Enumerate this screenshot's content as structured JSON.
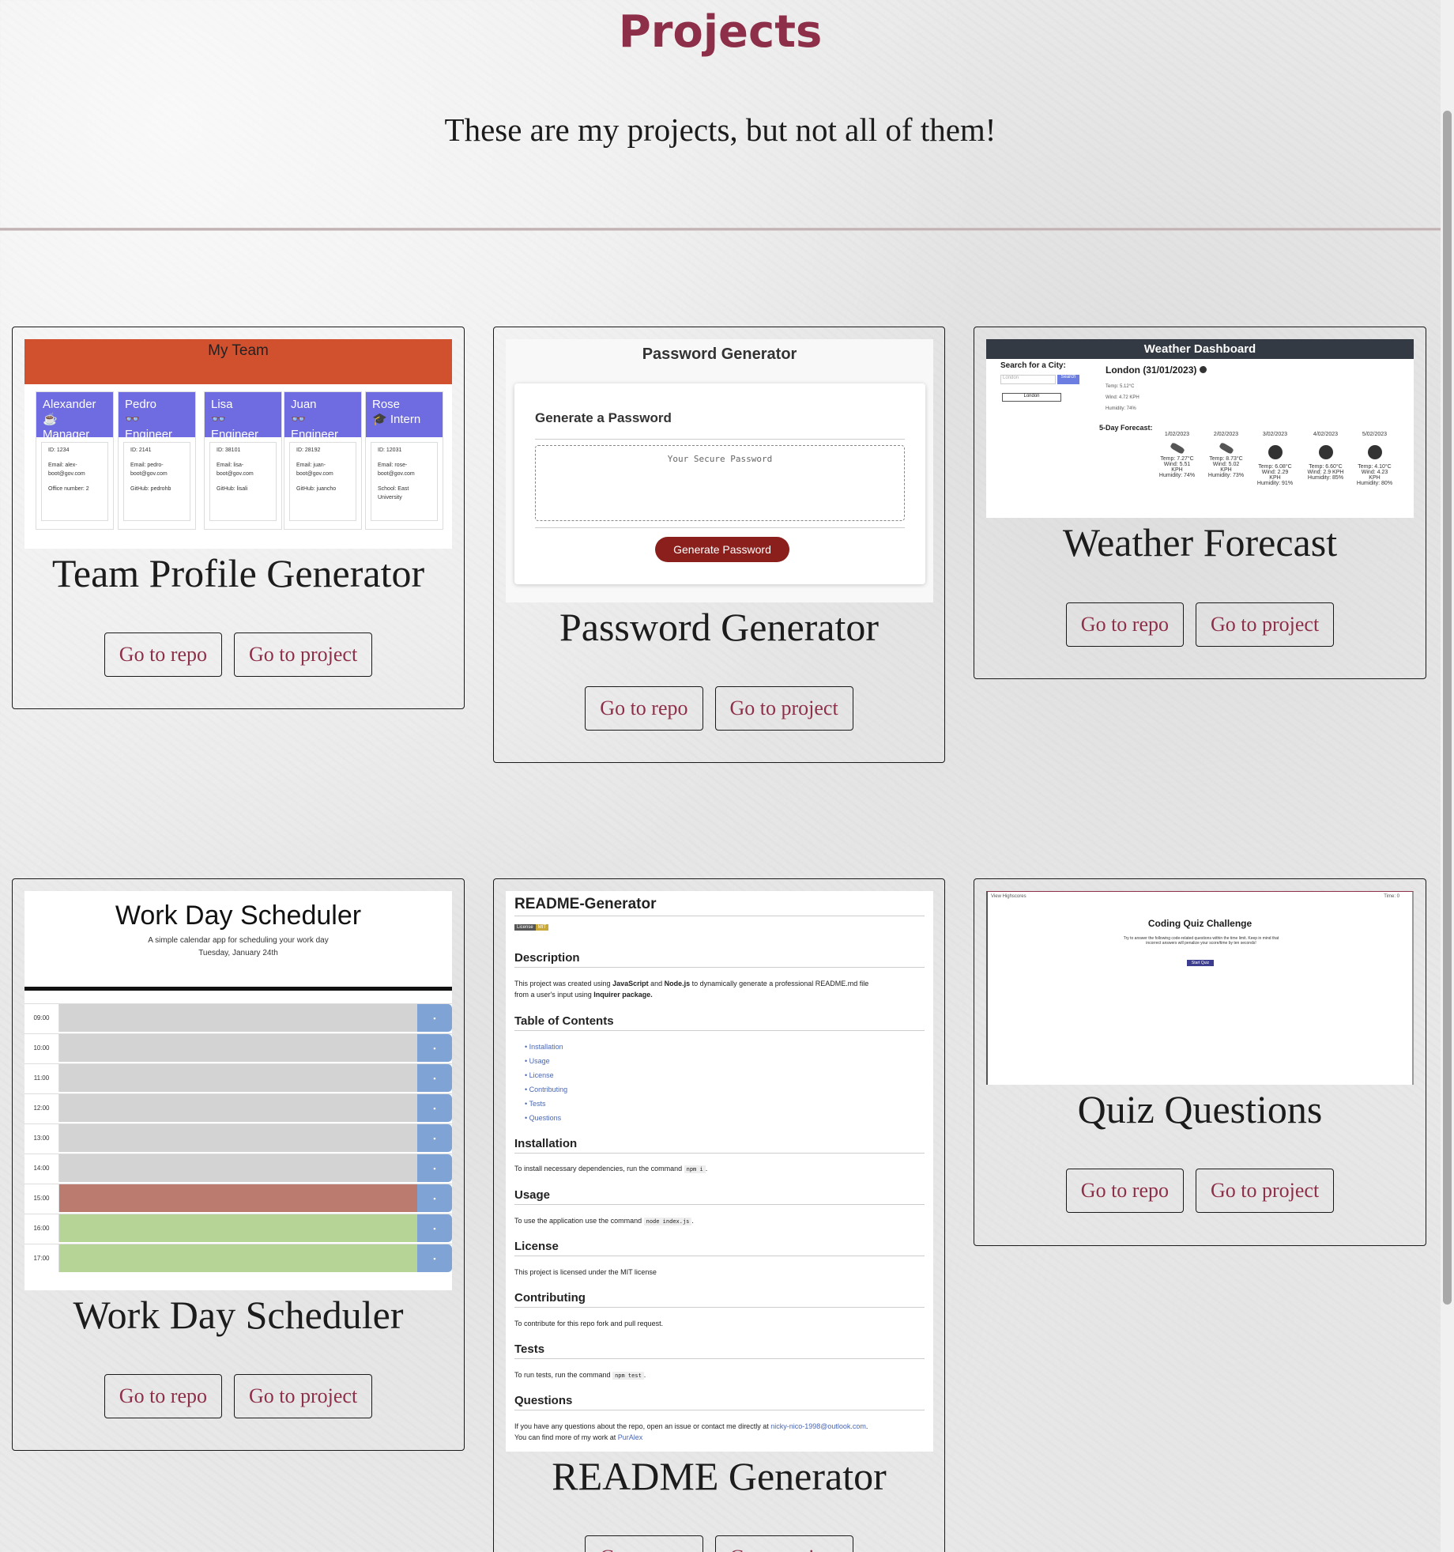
{
  "page": {
    "title": "Projects",
    "subtitle": "These are my projects, but not all of them!"
  },
  "buttons": {
    "repo": "Go to repo",
    "project": "Go to project"
  },
  "projects": [
    {
      "name": "Team Profile Generator",
      "preview": {
        "header": "My Team",
        "members": [
          {
            "name": "Alexander",
            "role": "Manager",
            "id": "ID: 1234",
            "email": "Email: alex-boot@gov.com",
            "extra": "Office number: 2"
          },
          {
            "name": "Pedro",
            "role": "Engineer",
            "id": "ID: 2141",
            "email": "Email: pedro-boot@gov.com",
            "extra": "GitHub: pedrohb"
          },
          {
            "name": "Lisa",
            "role": "Engineer",
            "id": "ID: 38101",
            "email": "Email: lisa-boot@gov.com",
            "extra": "GitHub: lisali"
          },
          {
            "name": "Juan",
            "role": "Engineer",
            "id": "ID: 28192",
            "email": "Email: juan-boot@gov.com",
            "extra": "GitHub: juancho"
          },
          {
            "name": "Rose",
            "role": "Intern",
            "id": "ID: 12031",
            "email": "Email: rose-boot@gov.com",
            "extra": "School: East University"
          }
        ]
      }
    },
    {
      "name": "Password Generator",
      "preview": {
        "header": "Password Generator",
        "card_title": "Generate a Password",
        "placeholder": "Your Secure Password",
        "button": "Generate Password"
      }
    },
    {
      "name": "Weather Forecast",
      "preview": {
        "header": "Weather Dashboard",
        "search_label": "Search for a City:",
        "search_value": "London",
        "search_button": "Search",
        "history_item": "London",
        "city": "London (31/01/2023)",
        "temp": "Temp: 5.12°C",
        "wind": "Wind: 4.72 KPH",
        "humidity": "Humidity: 74%",
        "forecast_label": "5-Day Forecast:",
        "forecast": [
          {
            "date": "1/02/2023",
            "temp": "Temp: 7.27°C",
            "wind": "Wind: 5.51 KPH",
            "humidity": "Humidity: 74%"
          },
          {
            "date": "2/02/2023",
            "temp": "Temp: 8.73°C",
            "wind": "Wind: 5.02 KPH",
            "humidity": "Humidity: 73%"
          },
          {
            "date": "3/02/2023",
            "temp": "Temp: 6.08°C",
            "wind": "Wind: 2.29 KPH",
            "humidity": "Humidity: 91%"
          },
          {
            "date": "4/02/2023",
            "temp": "Temp: 6.60°C",
            "wind": "Wind: 2.9 KPH",
            "humidity": "Humidity: 85%"
          },
          {
            "date": "5/02/2023",
            "temp": "Temp: 4.10°C",
            "wind": "Wind: 4.23 KPH",
            "humidity": "Humidity: 80%"
          }
        ]
      }
    },
    {
      "name": "Work Day Scheduler",
      "preview": {
        "header": "Work Day Scheduler",
        "tagline": "A simple calendar app for scheduling your work day",
        "date": "Tuesday, January 24th",
        "hours": [
          {
            "time": "09:00",
            "state": "past"
          },
          {
            "time": "10:00",
            "state": "past"
          },
          {
            "time": "11:00",
            "state": "past"
          },
          {
            "time": "12:00",
            "state": "past"
          },
          {
            "time": "13:00",
            "state": "past"
          },
          {
            "time": "14:00",
            "state": "past"
          },
          {
            "time": "15:00",
            "state": "present"
          },
          {
            "time": "16:00",
            "state": "future"
          },
          {
            "time": "17:00",
            "state": "future"
          }
        ],
        "colors": {
          "past": "#d3d3d3",
          "present": "#bb7b6e",
          "future": "#b6d496"
        }
      }
    },
    {
      "name": "README Generator",
      "preview": {
        "header": "README-Generator",
        "badge_left": "License",
        "badge_right": "MIT",
        "sections": {
          "description": "Description",
          "toc": "Table of Contents",
          "installation": "Installation",
          "usage": "Usage",
          "license": "License",
          "contributing": "Contributing",
          "tests": "Tests",
          "questions": "Questions"
        },
        "description_a": "This project was created using ",
        "description_js": "JavaScript",
        "description_and": " and ",
        "description_node": "Node.js",
        "description_b": " to dynamically generate a professional README.md file",
        "description_c": "from a user's input using ",
        "description_inq": "Inquirer package.",
        "toc_items": [
          "Installation",
          "Usage",
          "License",
          "Contributing",
          "Tests",
          "Questions"
        ],
        "install_text": "To install necessary dependencies, run the command ",
        "install_cmd": "npm i",
        "usage_text": "To use the application use the command ",
        "usage_cmd": "node index.js",
        "license_text": "This project is licensed under the MIT license",
        "contrib_text": "To contribute for this repo fork and pull request.",
        "tests_text": "To run tests, run the command ",
        "tests_cmd": "npm test",
        "questions_a": "If you have any questions about the repo, open an issue or contact me directly at ",
        "questions_email": "nicky-nico-1998@outlook.com",
        "questions_b": "You can find more of my work at ",
        "questions_user": "PurAlex"
      }
    },
    {
      "name": "Quiz Questions",
      "preview": {
        "highscores": "View Highscores",
        "timer": "Time: 0",
        "header": "Coding Quiz Challenge",
        "text": "Try to answer the following code-related questions within the time limit. Keep in mind that incorrect answers will penalize your score/time by ten seconds!",
        "button": "Start Quiz"
      }
    }
  ]
}
